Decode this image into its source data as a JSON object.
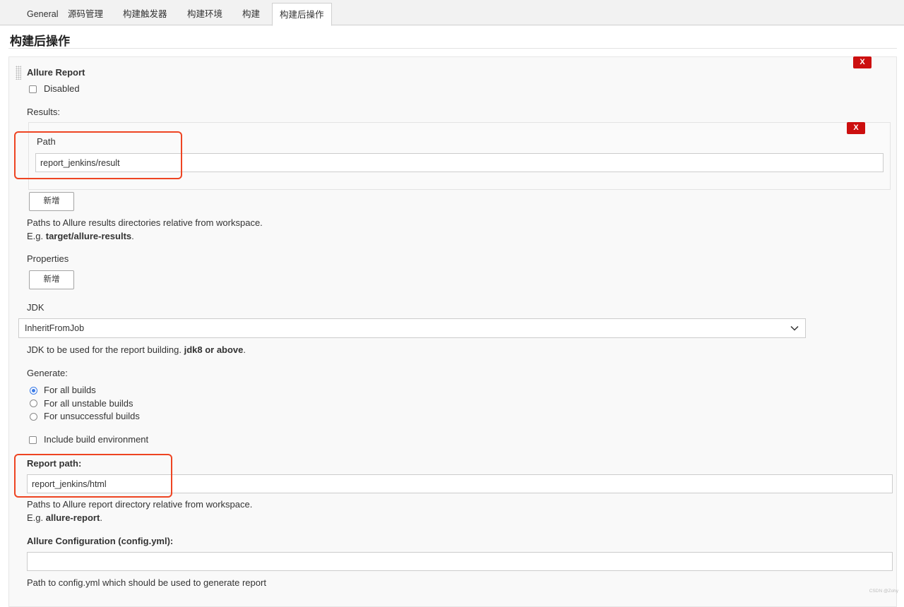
{
  "tabs": [
    {
      "label": "General"
    },
    {
      "label": "源码管理"
    },
    {
      "label": "构建触发器"
    },
    {
      "label": "构建环境"
    },
    {
      "label": "构建"
    },
    {
      "label": "构建后操作"
    }
  ],
  "active_tab": "构建后操作",
  "section_title": "构建后操作",
  "allure": {
    "title": "Allure Report",
    "delete_label": "X",
    "disabled_label": "Disabled",
    "disabled_checked": false,
    "results": {
      "label": "Results:",
      "path_label": "Path",
      "path_value": "report_jenkins/result",
      "delete_label": "X",
      "add_label": "新增",
      "help_line1": "Paths to Allure results directories relative from workspace.",
      "help_eg_prefix": "E.g. ",
      "help_eg_bold": "target/allure-results",
      "help_eg_suffix": "."
    },
    "properties": {
      "label": "Properties",
      "add_label": "新增"
    },
    "jdk": {
      "label": "JDK",
      "selected": "InheritFromJob",
      "help_prefix": "JDK to be used for the report building. ",
      "help_bold": "jdk8 or above",
      "help_suffix": "."
    },
    "generate": {
      "label": "Generate:",
      "options": [
        {
          "label": "For all builds",
          "selected": true
        },
        {
          "label": "For all unstable builds",
          "selected": false
        },
        {
          "label": "For unsuccessful builds",
          "selected": false
        }
      ]
    },
    "include_env_label": "Include build environment",
    "include_env_checked": false,
    "report_path": {
      "label": "Report path:",
      "value": "report_jenkins/html",
      "help_line1": "Paths to Allure report directory relative from workspace.",
      "help_eg_prefix": "E.g. ",
      "help_eg_bold": "allure-report",
      "help_eg_suffix": "."
    },
    "config": {
      "label": "Allure Configuration (config.yml):",
      "value": "",
      "help": "Path to config.yml which should be used to generate report"
    }
  },
  "highlight_color": "#ee4422",
  "delete_color": "#cc0f0f",
  "radio_color": "#3b7be6",
  "watermark": "CSDN @Zohy"
}
